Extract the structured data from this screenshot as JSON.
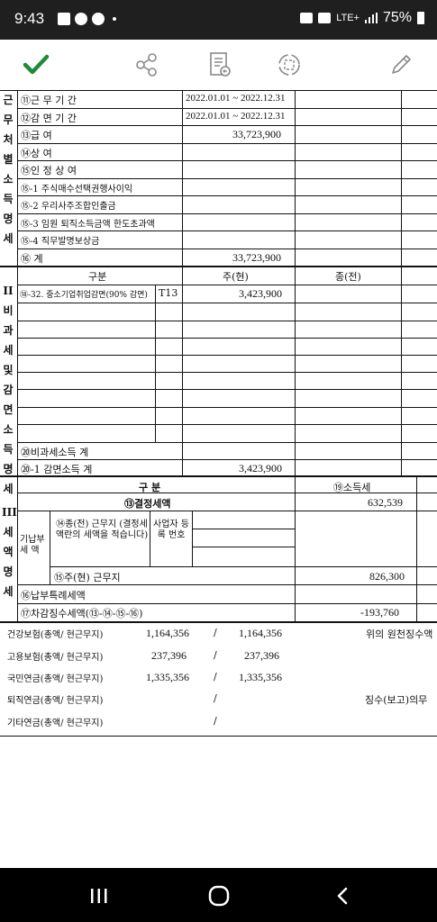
{
  "status_bar": {
    "time": "9:43",
    "network": "LTE+",
    "battery": "75%"
  },
  "toolbar": {
    "icons": [
      "check-icon",
      "share-icon",
      "pdf-export-icon",
      "crop-icon",
      "edit-pen-icon"
    ]
  },
  "doc": {
    "section1_side": "근무처별소득명세",
    "section1": [
      {
        "label": "⑪근 무 기 간",
        "value": "2022.01.01 ~ 2022.12.31"
      },
      {
        "label": "⑫감 면 기 간",
        "value": "2022.01.01 ~ 2022.12.31"
      },
      {
        "label": "⑬급      여",
        "value": "33,723,900"
      },
      {
        "label": "⑭상      여",
        "value": ""
      },
      {
        "label": "⑮인 정 상 여",
        "value": ""
      },
      {
        "label": "⑮-1 주식매수선택권행사이익",
        "value": ""
      },
      {
        "label": "⑮-2 우리사주조합인출금",
        "value": ""
      },
      {
        "label": "⑮-3 임원 퇴직소득금액 한도초과액",
        "value": ""
      },
      {
        "label": "⑮-4 직무발명보상금",
        "value": ""
      },
      {
        "label": "⑯        계",
        "value": "33,723,900"
      }
    ],
    "section2_side": "II비과세및감면소득명세",
    "section2_header": {
      "col1": "구분",
      "col2": "주(현)",
      "col3": "종(전)"
    },
    "section2_row": {
      "label": "⑱-32. 중소기업취업감면(90% 감면)",
      "code": "T13",
      "value": "3,423,900"
    },
    "section2_total1": {
      "label": "⑳비과세소득 계",
      "value": ""
    },
    "section2_total2": {
      "label": "⑳-1 감면소득 계",
      "value": "3,423,900"
    },
    "section3_side": "III세액명세",
    "section3_header": {
      "col1": "구  분",
      "col2": "⑲소득세"
    },
    "section3_rows": {
      "determined": {
        "label": "⑬결정세액",
        "value": "632,539"
      },
      "paid_label": "기납부 세 액",
      "prev_label": "⑭종(전) 근무지 (결정세액란의 세액을 적습니다)",
      "bizno_label": "사업자 등록 번호",
      "curr": {
        "label": "⑮주(현) 근무지",
        "value": "826,300"
      },
      "special": {
        "label": "⑯납부특례세액",
        "value": ""
      },
      "diff": {
        "label": "⑰차감징수세액(⑬-⑭-⑮-⑯)",
        "value": "-193,760"
      }
    },
    "insurance": [
      {
        "label": "건강보험(총액/ 현근무지)",
        "total": "1,164,356",
        "sep": "/",
        "current": "1,164,356"
      },
      {
        "label": "고용보험(총액/ 현근무지)",
        "total": "237,396",
        "sep": "/",
        "current": "237,396"
      },
      {
        "label": "국민연금(총액/ 현근무지)",
        "total": "1,335,356",
        "sep": "/",
        "current": "1,335,356"
      },
      {
        "label": "퇴직연금(총액/ 현근무지)",
        "total": "",
        "sep": "/",
        "current": ""
      },
      {
        "label": "기타연금(총액/ 현근무지)",
        "total": "",
        "sep": "/",
        "current": ""
      }
    ],
    "right_note1": "위의 원천징수액",
    "right_note2": "징수(보고)의무"
  },
  "navbar": {
    "icons": [
      "recent-apps-icon",
      "home-icon",
      "back-icon"
    ]
  }
}
